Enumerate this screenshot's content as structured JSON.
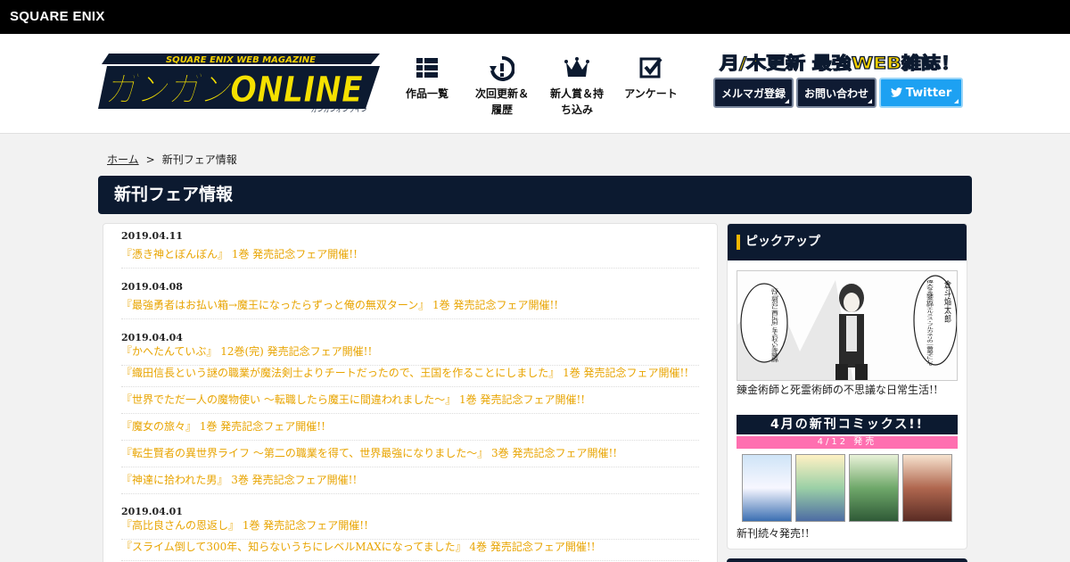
{
  "corp": {
    "name": "SQUARE ENIX"
  },
  "logo": {
    "title": "ガンガンONLINE",
    "banner": "SQUARE ENIX WEB MAGAZINE",
    "sub": "ガンガンオンライン"
  },
  "nav": [
    {
      "label": "作品一覧",
      "icon": "grid-list-icon"
    },
    {
      "label": "次回更新＆履歴",
      "icon": "clock-refresh-icon"
    },
    {
      "label": "新人賞＆持ち込み",
      "icon": "crown-icon"
    },
    {
      "label": "アンケート",
      "icon": "checkbox-icon"
    }
  ],
  "tagline": "月/木更新 最強WEB雑誌！",
  "buttons": {
    "mailmag": "メルマガ登録",
    "contact": "お問い合わせ",
    "twitter": "Twitter"
  },
  "breadcrumb": {
    "home": "ホーム",
    "sep": ">",
    "current": "新刊フェア情報"
  },
  "page_title": "新刊フェア情報",
  "groups": [
    {
      "date": "2019.04.11",
      "items": [
        "『憑き神とぼんぼん』 1巻 発売記念フェア開催!!"
      ]
    },
    {
      "date": "2019.04.08",
      "items": [
        "『最強勇者はお払い箱→魔王になったらずっと俺の無双ターン』 1巻 発売記念フェア開催!!"
      ]
    },
    {
      "date": "2019.04.04",
      "items": [
        "『かへたんていぶ』 12巻(完) 発売記念フェア開催!!",
        "『織田信長という謎の職業が魔法剣士よりチートだったので、王国を作ることにしました』 1巻 発売記念フェア開催!!",
        "『世界でただ一人の魔物使い ～転職したら魔王に間違われました～』 1巻 発売記念フェア開催!!",
        "『魔女の旅々』 1巻 発売記念フェア開催!!",
        "『転生賢者の異世界ライフ ～第二の職業を得て、世界最強になりました～』 3巻 発売記念フェア開催!!",
        "『神達に拾われた男』 3巻 発売記念フェア開催!!"
      ]
    },
    {
      "date": "2019.04.01",
      "items": [
        "『高比良さんの恩返し』 1巻 発売記念フェア開催!!",
        "『スライム倒して300年、知らないうちにレベルMAXになってました』 4巻 発売記念フェア開催!!"
      ]
    }
  ],
  "sidebar": {
    "heading": "ピックアップ",
    "pickups": [
      {
        "caption": "錬金術師と死霊術師の不思議な日常生活!!",
        "bubbles": [
          "倉斗焔太郎",
          "偉大なる錬金術師エルメス・フルカネリの一番弟子にして",
          "一時は「賢者の石に二番目に近い男」とまで言われていた天才錬金術師"
        ]
      },
      {
        "caption": "新刊続々発売!!",
        "banner": "4月の新刊コミックス!!",
        "sub": "4/12 発売"
      }
    ]
  },
  "colors": {
    "navy": "#0c1a30",
    "accent_gold": "#e8a400",
    "twitter": "#1da1f2",
    "pink": "#ff6fb0",
    "highlight": "#f2b600"
  }
}
